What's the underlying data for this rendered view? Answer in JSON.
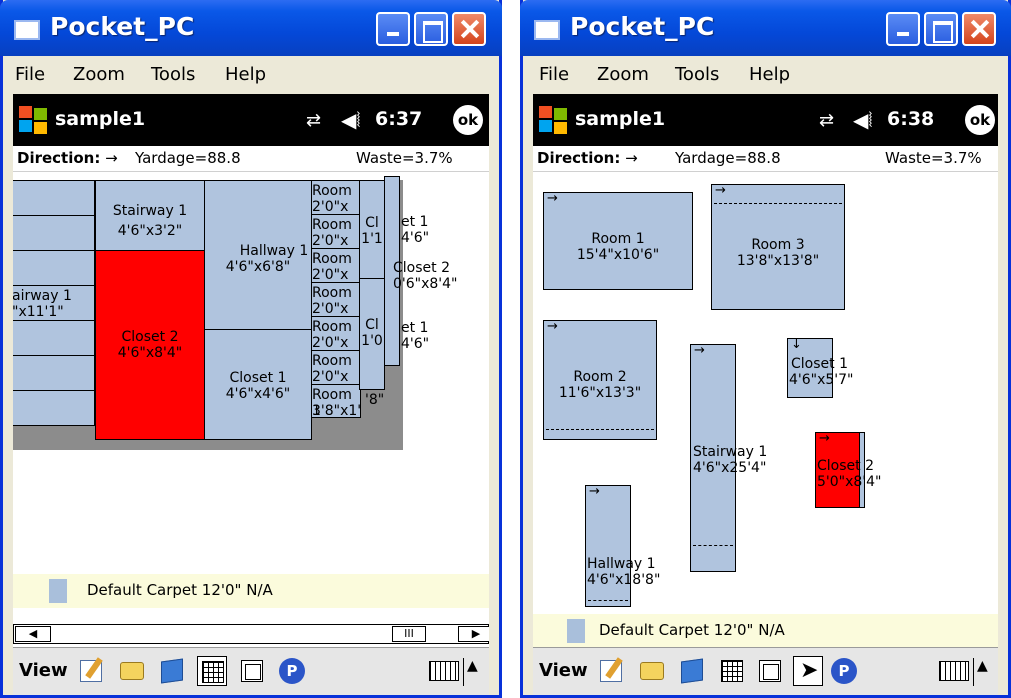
{
  "window_title": "Pocket_PC",
  "menu": [
    "File",
    "Zoom",
    "Tools",
    "Help"
  ],
  "app_name": "sample1",
  "left": {
    "time": "6:37",
    "ok": "ok",
    "direction_label": "Direction:",
    "direction_arrow": "→",
    "yardage": "Yardage=88.8",
    "waste": "Waste=3.7%",
    "pieces": [
      {
        "name": "Stairway 1",
        "size": "4'6\"x3'2\""
      },
      {
        "name": "Hallway 1",
        "size": "4'6\"x6'8\""
      },
      {
        "name": "Closet 2",
        "size": "4'6\"x8'4\""
      },
      {
        "name": "Closet 1",
        "size": "4'6\"x4'6\""
      },
      {
        "name": "airway 1",
        "size": "\"x11'1\""
      },
      {
        "name": "Room",
        "size": "2'0\"x"
      },
      {
        "name": "Cl",
        "size": "1'1"
      },
      {
        "name": "et 1",
        "size": "4'6\""
      },
      {
        "name": "Closet 2",
        "size": "0'6\"x8'4\""
      },
      {
        "name": "Cl",
        "size": "1'0"
      },
      {
        "name": "et 1",
        "size": "4'6\""
      },
      {
        "name": "Room 3",
        "size": "1'8\"x1'8\""
      },
      {
        "name": "'8\"",
        "size": ""
      }
    ],
    "legend": "Default Carpet 12'0\" N/A"
  },
  "right": {
    "time": "6:38",
    "ok": "ok",
    "direction_label": "Direction:",
    "direction_arrow": "→",
    "yardage": "Yardage=88.8",
    "waste": "Waste=3.7%",
    "pieces": [
      {
        "name": "Room 1",
        "size": "15'4\"x10'6\""
      },
      {
        "name": "Room 3",
        "size": "13'8\"x13'8\""
      },
      {
        "name": "Room 2",
        "size": "11'6\"x13'3\""
      },
      {
        "name": "Stairway 1",
        "size": "4'6\"x25'4\""
      },
      {
        "name": "Closet 1",
        "size": "4'6\"x5'7\""
      },
      {
        "name": "Closet 2",
        "size": "5'0\"x8'4\""
      },
      {
        "name": "Hallway 1",
        "size": "4'6\"x18'8\""
      }
    ],
    "legend": "Default Carpet 12'0\" N/A"
  },
  "toolbar": {
    "view_label": "View"
  },
  "colors": {
    "piece": "#b0c4de",
    "selected_piece": "#ff0000",
    "titlebar": "#0a58e8"
  },
  "icons": [
    "windows-start-icon",
    "sync-icon",
    "volume-icon",
    "pencil-icon",
    "printer-icon",
    "book-icon",
    "grid-view-icon",
    "window-view-icon",
    "pointer-icon",
    "p-icon",
    "keyboard-icon",
    "up-arrow-icon"
  ]
}
